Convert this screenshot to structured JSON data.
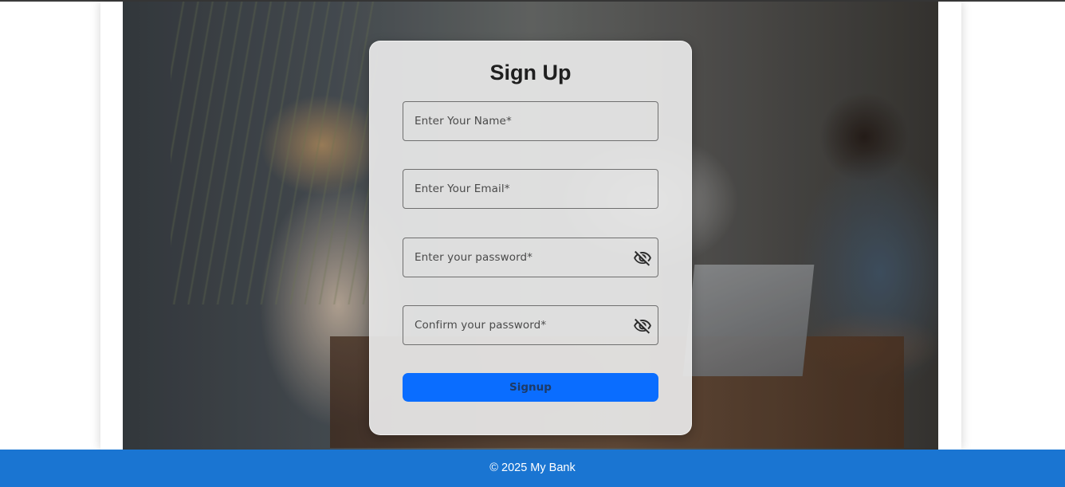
{
  "form": {
    "title": "Sign Up",
    "name_placeholder": "Enter Your Name*",
    "email_placeholder": "Enter Your Email*",
    "password_placeholder": "Enter your password*",
    "confirm_password_placeholder": "Confirm your password*",
    "password_toggle_icon": "eye-off-icon",
    "submit_label": "Signup"
  },
  "footer": {
    "text": "© 2025 My Bank"
  },
  "colors": {
    "accent": "#0a6dff",
    "footer_bg": "#1a75d2"
  }
}
